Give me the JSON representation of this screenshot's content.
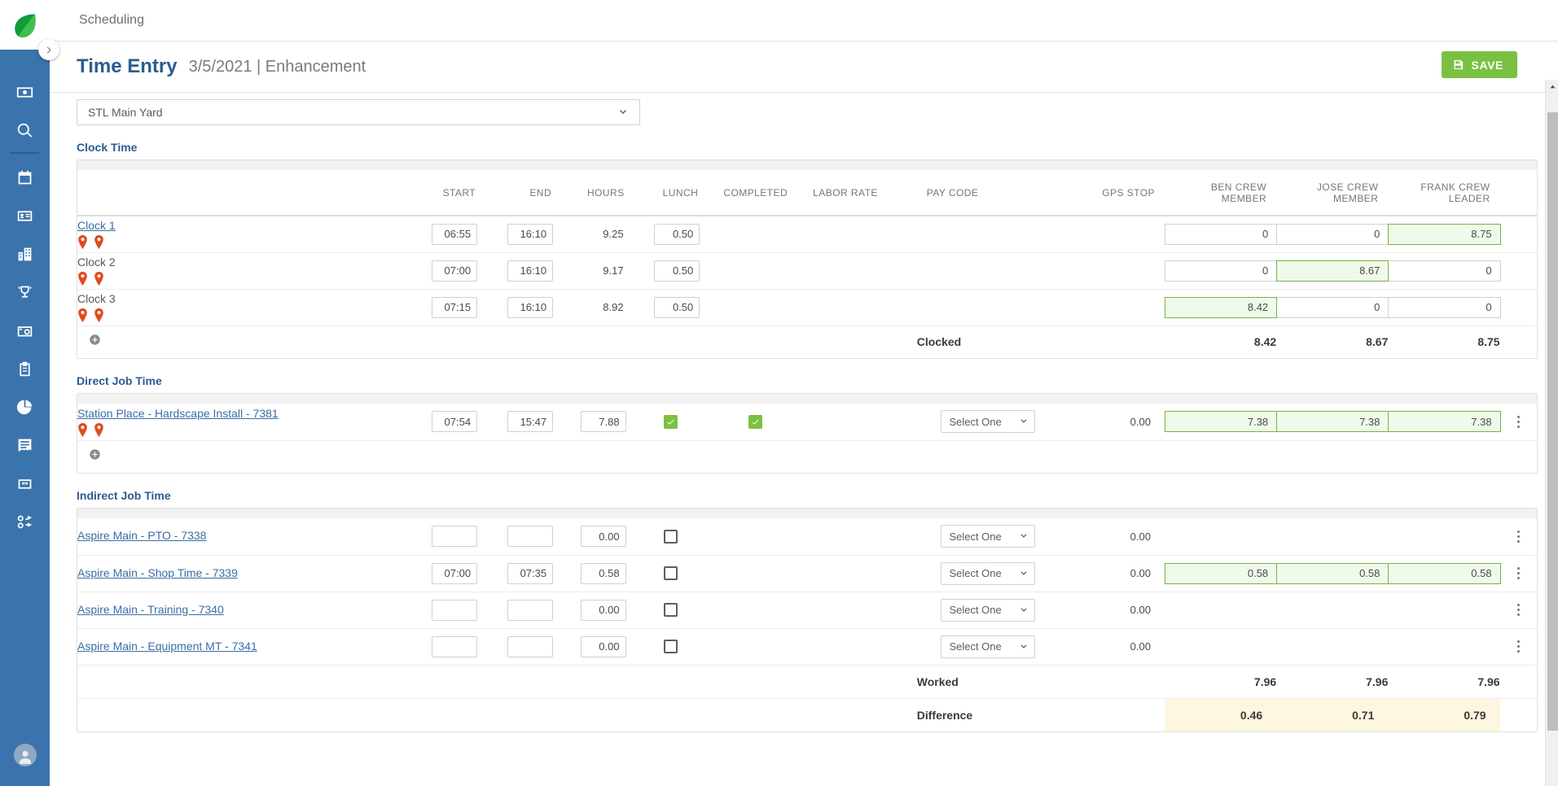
{
  "topbar": {
    "module": "Scheduling"
  },
  "header": {
    "title": "Time Entry",
    "subtitle": "3/5/2021 | Enhancement",
    "save_label": "SAVE",
    "save_color": "#7ac143"
  },
  "filters": {
    "yard_value": "STL Main Yard"
  },
  "sidebar": {
    "items": [
      {
        "icon": "money-bill-icon",
        "label": "Accounting"
      },
      {
        "icon": "search-icon",
        "label": "Search"
      },
      {
        "icon": "calendar-icon",
        "label": "Scheduling"
      },
      {
        "icon": "contact-card-icon",
        "label": "Contacts"
      },
      {
        "icon": "building-icon",
        "label": "Properties"
      },
      {
        "icon": "trophy-icon",
        "label": "Opportunities"
      },
      {
        "icon": "camera-timer-icon",
        "label": "Time"
      },
      {
        "icon": "clipboard-icon",
        "label": "Work Orders"
      },
      {
        "icon": "pie-chart-icon",
        "label": "Reports"
      },
      {
        "icon": "invoice-icon",
        "label": "Invoices"
      },
      {
        "icon": "cash-register-icon",
        "label": "Payments"
      },
      {
        "icon": "tools-icon",
        "label": "Equipment"
      }
    ]
  },
  "columns": {
    "name": "",
    "start": "START",
    "end": "END",
    "hours": "HOURS",
    "lunch": "LUNCH",
    "completed": "COMPLETED",
    "labor_rate": "LABOR RATE",
    "pay_code": "PAY CODE",
    "gps_stop": "GPS STOP",
    "crew": [
      "BEN CREW MEMBER",
      "JOSE CREW MEMBER",
      "FRANK CREW LEADER"
    ]
  },
  "clock_time": {
    "section_label": "Clock Time",
    "rows": [
      {
        "name": "Clock 1",
        "is_link": true,
        "pins": 2,
        "start": "06:55",
        "end": "16:10",
        "hours": "9.25",
        "lunch": "0.50",
        "crew": [
          {
            "value": "0",
            "highlight": false
          },
          {
            "value": "0",
            "highlight": false
          },
          {
            "value": "8.75",
            "highlight": true
          }
        ]
      },
      {
        "name": "Clock 2",
        "is_link": false,
        "pins": 2,
        "start": "07:00",
        "end": "16:10",
        "hours": "9.17",
        "lunch": "0.50",
        "crew": [
          {
            "value": "0",
            "highlight": false
          },
          {
            "value": "8.67",
            "highlight": true
          },
          {
            "value": "0",
            "highlight": false
          }
        ]
      },
      {
        "name": "Clock 3",
        "is_link": false,
        "pins": 2,
        "start": "07:15",
        "end": "16:10",
        "hours": "8.92",
        "lunch": "0.50",
        "crew": [
          {
            "value": "8.42",
            "highlight": true
          },
          {
            "value": "0",
            "highlight": false
          },
          {
            "value": "0",
            "highlight": false
          }
        ]
      }
    ],
    "total": {
      "label": "Clocked",
      "values": [
        "8.42",
        "8.67",
        "8.75"
      ]
    }
  },
  "direct_job_time": {
    "section_label": "Direct Job Time",
    "rows": [
      {
        "name": "Station Place - Hardscape Install - 7381",
        "is_link": true,
        "pins": 2,
        "start": "07:54",
        "end": "15:47",
        "hours": "7.88",
        "lunch_checked": true,
        "completed_checked": true,
        "pay_code": "Select One",
        "gps_stop": "0.00",
        "crew": [
          {
            "value": "7.38",
            "highlight": true
          },
          {
            "value": "7.38",
            "highlight": true
          },
          {
            "value": "7.38",
            "highlight": true
          }
        ]
      }
    ]
  },
  "indirect_job_time": {
    "section_label": "Indirect Job Time",
    "rows": [
      {
        "name": "Aspire Main - PTO - 7338",
        "is_link": true,
        "start": "",
        "end": "",
        "hours": "0.00",
        "lunch_checked": false,
        "pay_code": "Select One",
        "gps_stop": "0.00",
        "crew": [
          {
            "value": "",
            "highlight": false
          },
          {
            "value": "",
            "highlight": false
          },
          {
            "value": "",
            "highlight": false
          }
        ]
      },
      {
        "name": "Aspire Main - Shop Time - 7339",
        "is_link": true,
        "start": "07:00",
        "end": "07:35",
        "hours": "0.58",
        "lunch_checked": false,
        "pay_code": "Select One",
        "gps_stop": "0.00",
        "crew": [
          {
            "value": "0.58",
            "highlight": true
          },
          {
            "value": "0.58",
            "highlight": true
          },
          {
            "value": "0.58",
            "highlight": true
          }
        ]
      },
      {
        "name": "Aspire Main - Training - 7340",
        "is_link": true,
        "start": "",
        "end": "",
        "hours": "0.00",
        "lunch_checked": false,
        "pay_code": "Select One",
        "gps_stop": "0.00",
        "crew": [
          {
            "value": "",
            "highlight": false
          },
          {
            "value": "",
            "highlight": false
          },
          {
            "value": "",
            "highlight": false
          }
        ]
      },
      {
        "name": "Aspire Main - Equipment MT - 7341",
        "is_link": true,
        "start": "",
        "end": "",
        "hours": "0.00",
        "lunch_checked": false,
        "pay_code": "Select One",
        "gps_stop": "0.00",
        "crew": [
          {
            "value": "",
            "highlight": false
          },
          {
            "value": "",
            "highlight": false
          },
          {
            "value": "",
            "highlight": false
          }
        ]
      }
    ],
    "totals": [
      {
        "label": "Worked",
        "values": [
          "7.96",
          "7.96",
          "7.96"
        ],
        "style": "plain"
      },
      {
        "label": "Difference",
        "values": [
          "0.46",
          "0.71",
          "0.79"
        ],
        "style": "diff"
      }
    ]
  },
  "icons": {
    "add_row": "plus-circle-icon",
    "kebab": "more-vertical-icon",
    "pin": "map-pin-icon",
    "chevron": "chevron-down-icon",
    "collapse": "chevron-right-icon"
  },
  "colors": {
    "brand_blue": "#3b73ad",
    "title_blue": "#2c5c90",
    "accent_green": "#7ac143",
    "highlight_green_bg": "#effaea",
    "highlight_green_border": "#77b246",
    "difference_bg": "#fdf6e0",
    "pin_red": "#e04b1e"
  }
}
